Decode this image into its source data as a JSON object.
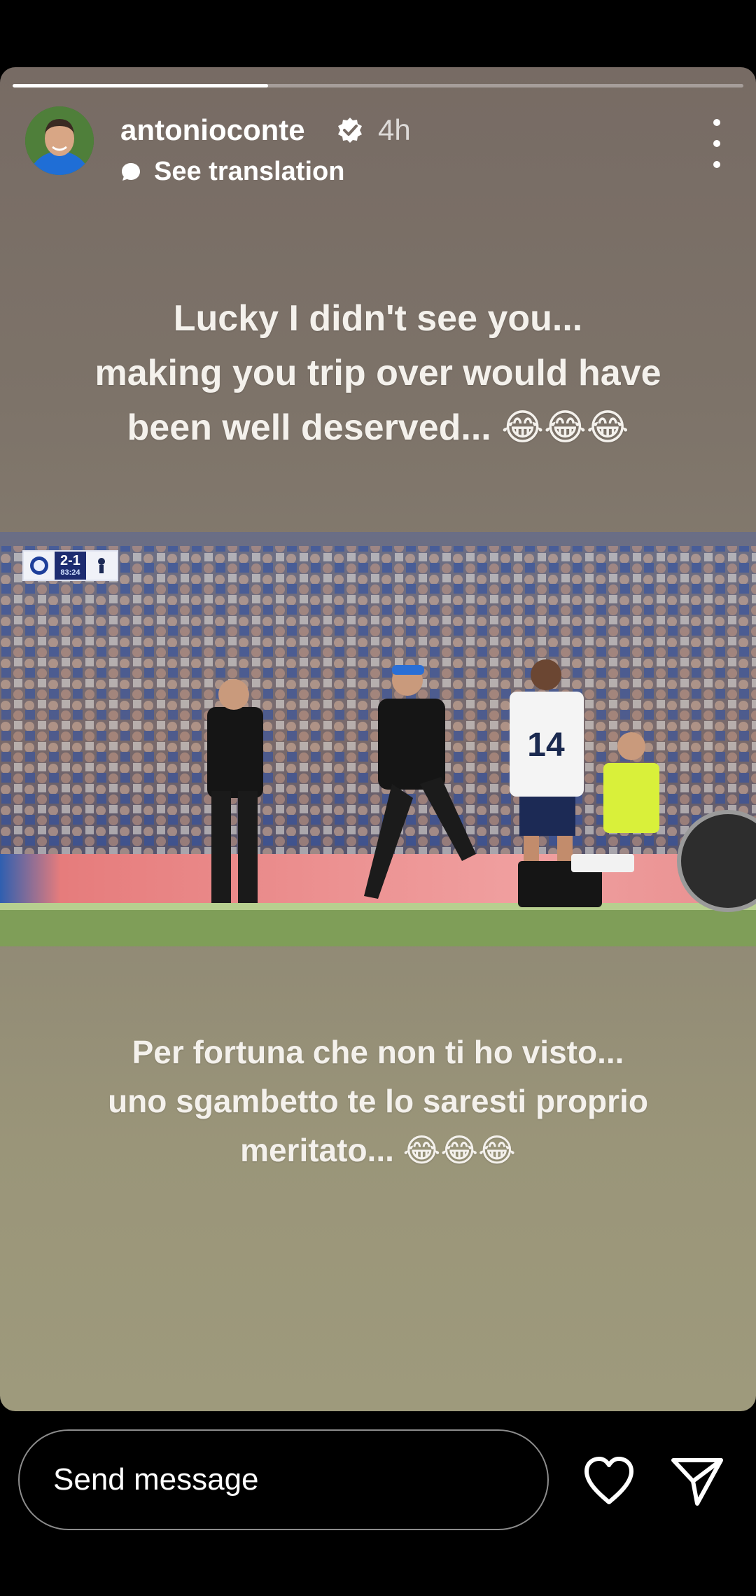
{
  "story": {
    "progress": [
      0.35,
      1.0
    ],
    "segments_total": 2,
    "account": {
      "username": "antonioconte",
      "verified": true,
      "time_ago": "4h"
    },
    "translate_label": "See translation",
    "caption_en_lines": [
      "Lucky I didn't see you...",
      "making you trip over would have",
      "been well deserved... 😂😂😂"
    ],
    "caption_it_lines": [
      "Per fortuna che non ti ho visto...",
      "uno sgambetto te lo saresti proprio",
      "meritato... 😂😂😂"
    ],
    "media": {
      "scoreboard": {
        "score": "2-1",
        "clock": "83:24"
      },
      "player_number": "14"
    }
  },
  "reply_bar": {
    "placeholder": "Send message"
  },
  "icons": {
    "more": "more-vertical-icon",
    "verified": "verified-badge-icon",
    "translate": "translate-bubble-icon",
    "like": "heart-outline-icon",
    "share": "send-paper-plane-icon"
  },
  "colors": {
    "background": "#000000",
    "story_top": "#776b64",
    "story_bottom": "#9e9a7c",
    "verified_badge": "#ffffff",
    "text": "#ffffff"
  }
}
